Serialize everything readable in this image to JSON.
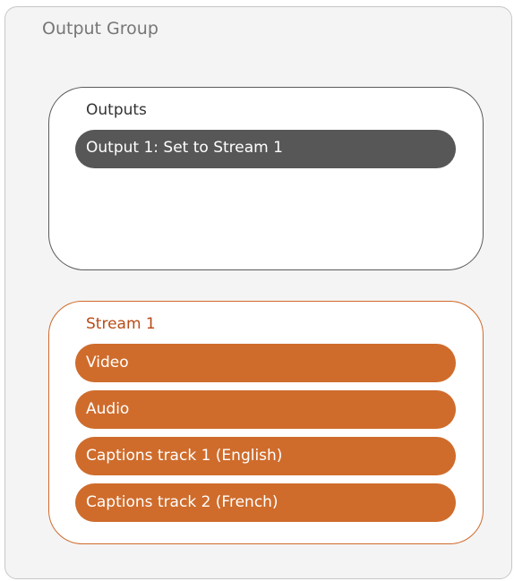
{
  "group": {
    "title": "Output Group"
  },
  "outputs": {
    "title": "Outputs",
    "items": [
      "Output 1: Set to Stream 1"
    ]
  },
  "stream": {
    "title": "Stream 1",
    "items": [
      "Video",
      "Audio",
      "Captions track 1 (English)",
      "Captions track 2 (French)"
    ]
  },
  "colors": {
    "group_bg": "#f4f4f4",
    "output_pill": "#575757",
    "stream_accent": "#cf6c2c",
    "stream_title": "#b84b17"
  }
}
